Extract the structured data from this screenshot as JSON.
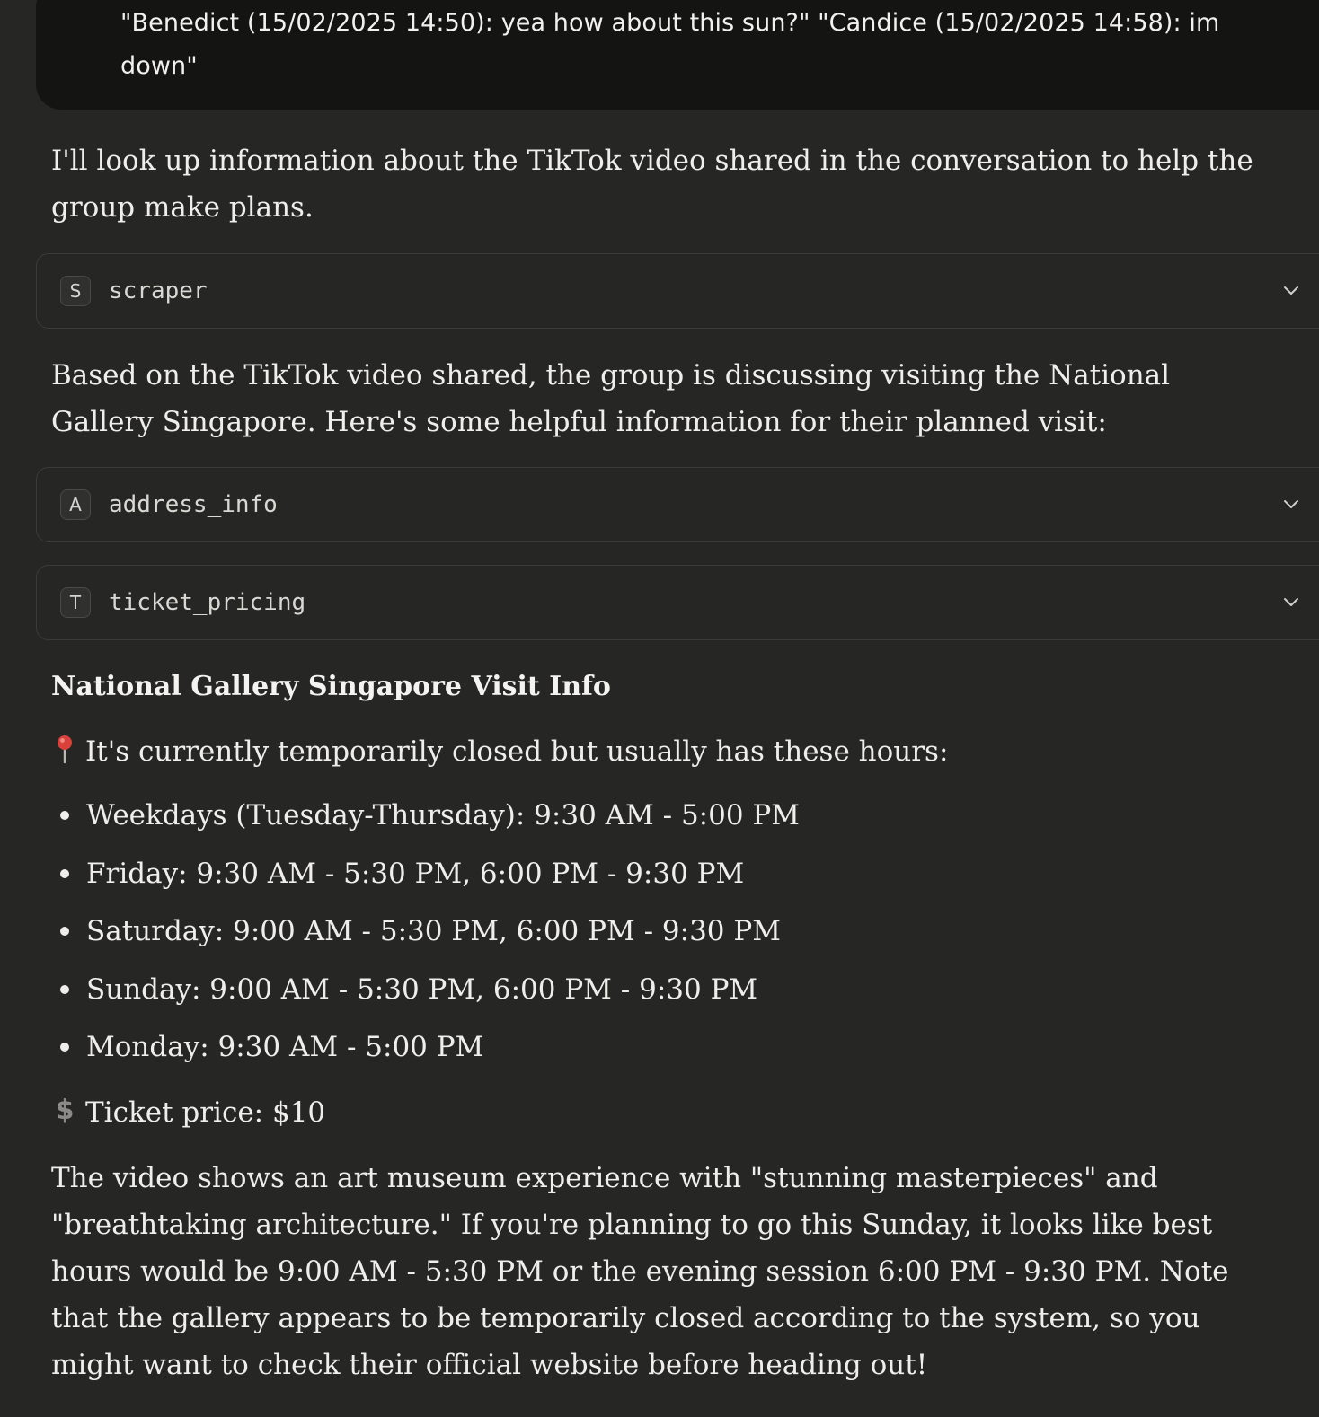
{
  "user_message": {
    "text": "\"Benedict (15/02/2025 14:50): yea how about this sun?\" \"Candice (15/02/2025 14:58): im down\""
  },
  "assistant": {
    "intro": "I'll look up information about the TikTok video shared in the conversation to help the group make plans.",
    "tools": [
      {
        "badge": "S",
        "name": "scraper",
        "icon": "chevron-down-icon"
      },
      {
        "badge": "A",
        "name": "address_info",
        "icon": "chevron-down-icon"
      },
      {
        "badge": "T",
        "name": "ticket_pricing",
        "icon": "chevron-down-icon"
      }
    ],
    "context": "Based on the TikTok video shared, the group is discussing visiting the National Gallery Singapore. Here's some helpful information for their planned visit:",
    "heading": "National Gallery Singapore Visit Info",
    "status_line": {
      "icon": "round-pushpin-icon",
      "text": "It's currently temporarily closed but usually has these hours:"
    },
    "hours": [
      "Weekdays (Tuesday-Thursday): 9:30 AM - 5:00 PM",
      "Friday: 9:30 AM - 5:30 PM, 6:00 PM - 9:30 PM",
      "Saturday: 9:00 AM - 5:30 PM, 6:00 PM - 9:30 PM",
      "Sunday: 9:00 AM - 5:30 PM, 6:00 PM - 9:30 PM",
      "Monday: 9:30 AM - 5:00 PM"
    ],
    "ticket_line": {
      "icon": "dollar-sign-icon",
      "text": "Ticket price: $10"
    },
    "closing": "The video shows an art museum experience with \"stunning masterpieces\" and \"breathtaking architecture.\" If you're planning to go this Sunday, it looks like best hours would be 9:00 AM - 5:30 PM or the evening session 6:00 PM - 9:30 PM. Note that the gallery appears to be temporarily closed according to the system, so you might want to check their official website before heading out!"
  },
  "colors": {
    "background": "#262624",
    "user_bubble": "#141413",
    "text": "#efeeeb",
    "tool_border": "#3b3b38",
    "pin_red": "#d9413a"
  }
}
